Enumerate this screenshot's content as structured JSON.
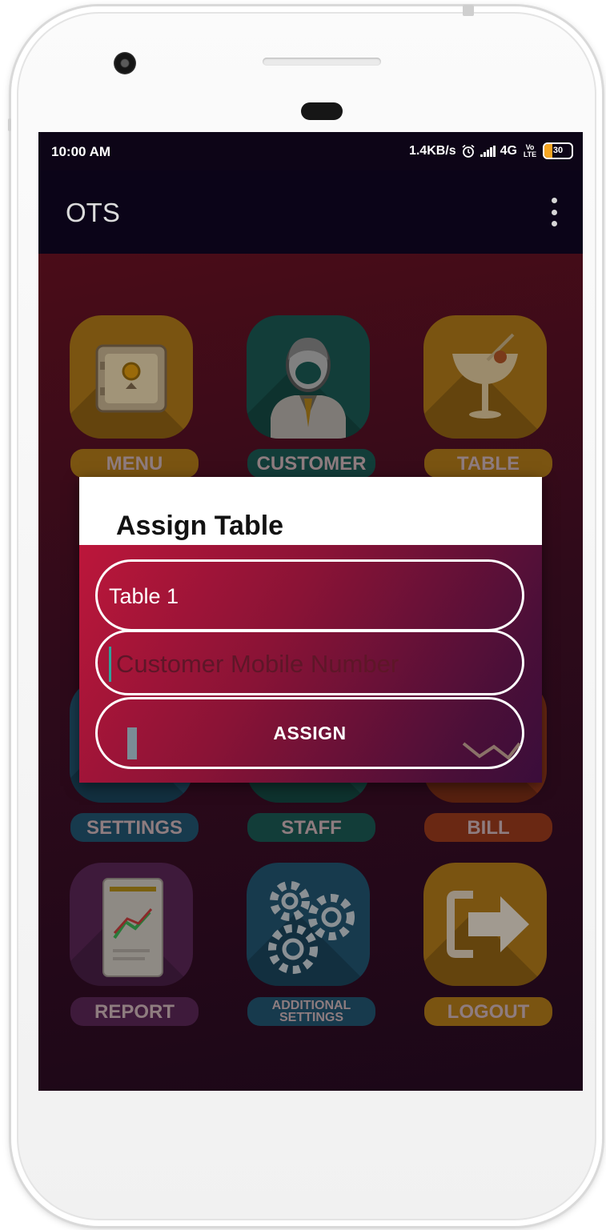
{
  "status_bar": {
    "time": "10:00 AM",
    "speed": "1.4KB/s",
    "network": "4G",
    "volte": "Vo LTE",
    "battery": "30",
    "alarm_icon": "alarm-icon",
    "signal_icon": "signal-icon"
  },
  "app_bar": {
    "title": "OTS",
    "menu_icon": "overflow-menu-icon"
  },
  "tiles": [
    {
      "label": "MENU",
      "icon": "safe-icon",
      "color": "#7a5411"
    },
    {
      "label": "CUSTOMER",
      "icon": "waiter-icon",
      "color": "#123d39"
    },
    {
      "label": "TABLE",
      "icon": "cocktail-glass-icon",
      "color": "#7a5411"
    },
    {
      "label": "SETTINGS",
      "icon": "settings-icon",
      "color": "#173a4d"
    },
    {
      "label": "STAFF",
      "icon": "staff-icon",
      "color": "#123d39"
    },
    {
      "label": "BILL",
      "icon": "bill-icon",
      "color": "#6a2813"
    },
    {
      "label": "REPORT",
      "icon": "report-chart-icon",
      "color": "#3e1a3b"
    },
    {
      "label": "ADDITIONAL SETTINGS",
      "icon": "gears-icon",
      "color": "#173a4d"
    },
    {
      "label": "LOGOUT",
      "icon": "logout-arrow-icon",
      "color": "#7a5411"
    }
  ],
  "dialog": {
    "title": "Assign Table",
    "table_value": "Table 1",
    "mobile_placeholder": "Customer Mobile Number",
    "assign_label": "ASSIGN"
  }
}
